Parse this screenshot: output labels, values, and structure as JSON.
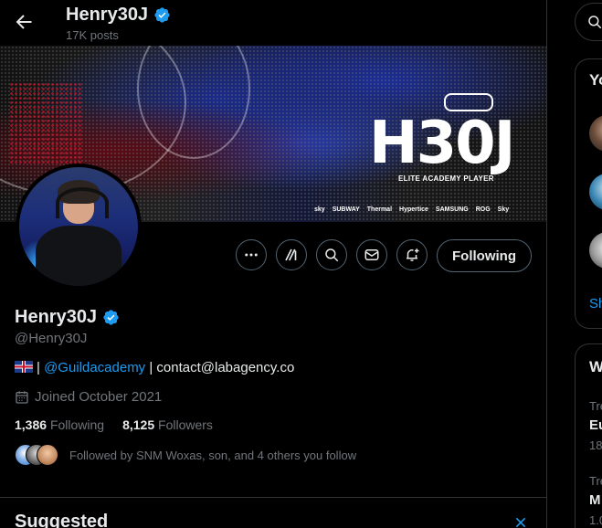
{
  "header": {
    "name": "Henry30J",
    "posts": "17K posts"
  },
  "banner": {
    "logo": "GUILD",
    "title": "H30J",
    "subtitle": "ELITE ACADEMY PLAYER",
    "sponsors": [
      "sky",
      "SUBWAY",
      "Thermal",
      "Hypertice",
      "SAMSUNG",
      "ROG",
      "Sky"
    ]
  },
  "actions": {
    "follow_label": "Following"
  },
  "profile": {
    "name": "Henry30J",
    "handle": "@Henry30J",
    "bio_link": "@Guildacademy",
    "bio_sep": "|",
    "bio_contact": "| contact@labagency.co",
    "joined": "Joined October 2021",
    "following_count": "1,386",
    "following_label": "Following",
    "followers_count": "8,125",
    "followers_label": "Followers",
    "followed_by": "Followed by SNM Woxas, son, and 4 others you follow"
  },
  "suggested": {
    "title": "Suggested"
  },
  "right": {
    "card1_title": "Yo",
    "card1_link": "Sh",
    "card2_title": "W",
    "trend1_meta": "Tre",
    "trend1_name": "Eu",
    "trend1_count": "18",
    "trend2_meta": "Tre",
    "trend2_name": "M",
    "trend2_count": "1.0"
  },
  "colors": {
    "accent": "#1d9bf0",
    "muted": "#71767b",
    "border": "#2f3336",
    "verified": "#1d9bf0"
  }
}
